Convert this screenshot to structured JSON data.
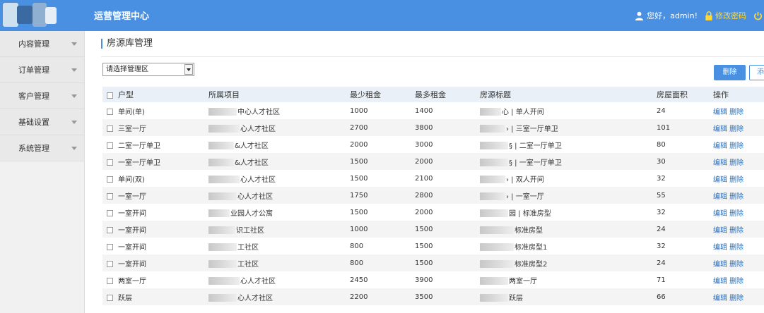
{
  "header": {
    "app_title": "运营管理中心",
    "greeting": "您好，admin!",
    "change_password": "修改密码"
  },
  "sidebar": {
    "items": [
      {
        "label": "内容管理"
      },
      {
        "label": "订单管理"
      },
      {
        "label": "客户管理"
      },
      {
        "label": "基础设置"
      },
      {
        "label": "系统管理"
      }
    ]
  },
  "main": {
    "page_title": "房源库管理",
    "area_select": "请选择管理区",
    "delete_button": "删除",
    "add_button": "添"
  },
  "table": {
    "headers": [
      "户型",
      "所属项目",
      "最少租金",
      "最多租金",
      "房源标题",
      "房屋面积",
      "操作"
    ],
    "edit_label": "编辑",
    "delete_label": "删除",
    "rows": [
      {
        "type": "单间(单)",
        "project": "中心人才社区",
        "min": "1000",
        "max": "1400",
        "title": "心 | 单人开间",
        "area": "24"
      },
      {
        "type": "三室一厅",
        "project": "心人才社区",
        "min": "2700",
        "max": "3800",
        "title": "› | 三室一厅单卫",
        "area": "101"
      },
      {
        "type": "二室一厅单卫",
        "project": "&人才社区",
        "min": "2000",
        "max": "3000",
        "title": "§ | 二室一厅单卫",
        "area": "80"
      },
      {
        "type": "一室一厅单卫",
        "project": "&人才社区",
        "min": "1500",
        "max": "2000",
        "title": "§ | 一室一厅单卫",
        "area": "30"
      },
      {
        "type": "单间(双)",
        "project": "心人才社区",
        "min": "1500",
        "max": "2100",
        "title": "› | 双人开间",
        "area": "32"
      },
      {
        "type": "一室一厅",
        "project": "心人才社区",
        "min": "1750",
        "max": "2800",
        "title": "› | 一室一厅",
        "area": "55"
      },
      {
        "type": "一室开间",
        "project": "业园人才公寓",
        "min": "1500",
        "max": "2000",
        "title": "园 | 标准房型",
        "area": "32"
      },
      {
        "type": "一室开间",
        "project": "识工社区",
        "min": "1000",
        "max": "1500",
        "title": "标准房型",
        "area": "24"
      },
      {
        "type": "一室开间",
        "project": "工社区",
        "min": "800",
        "max": "1500",
        "title": "标准房型1",
        "area": "32"
      },
      {
        "type": "一室开间",
        "project": "工社区",
        "min": "800",
        "max": "1500",
        "title": "标准房型2",
        "area": "24"
      },
      {
        "type": "两室一厅",
        "project": "心人才社区",
        "min": "2450",
        "max": "3900",
        "title": "两室一厅",
        "area": "71"
      },
      {
        "type": "跃层",
        "project": "心人才社区",
        "min": "2200",
        "max": "3500",
        "title": "跃层",
        "area": "66"
      }
    ]
  },
  "colors": {
    "header_bg": "#4a90e2",
    "accent": "#4a90e2",
    "link": "#2a6ebb",
    "change_password": "#ffd83a"
  },
  "icons": [
    "user-icon",
    "lock-icon",
    "power-icon",
    "chevron-down-icon",
    "checkbox-icon"
  ]
}
